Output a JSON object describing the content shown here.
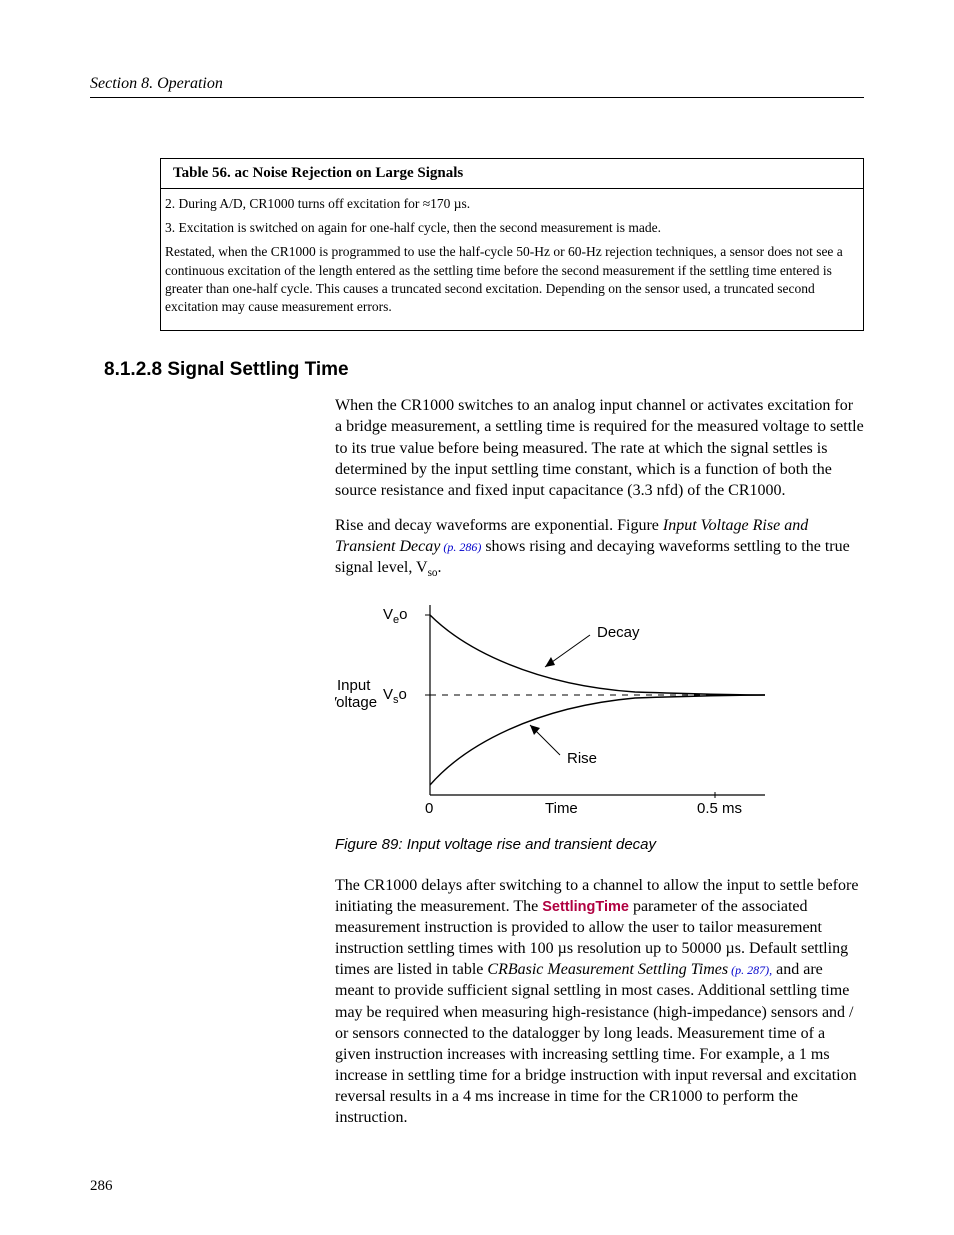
{
  "header": {
    "running": "Section 8.  Operation"
  },
  "table": {
    "title": "Table 56. ac Noise Rejection on Large Signals",
    "line2": "2. During A/D, CR1000 turns off excitation for ≈170 µs.",
    "line3": "3. Excitation is switched on again for one-half cycle, then the second measurement is made.",
    "para": "Restated, when the CR1000 is programmed to use the half-cycle 50-Hz or 60-Hz rejection techniques, a sensor does not see a continuous excitation of the length entered as the settling time before the second measurement if the settling time entered is greater than one-half cycle. This causes a truncated second excitation.  Depending on the sensor used, a truncated second excitation may cause measurement errors."
  },
  "section": {
    "heading": "8.1.2.8 Signal Settling Time",
    "p1": "When the CR1000 switches to an analog input channel or activates excitation for a bridge measurement, a settling time is required for the measured voltage to settle to its true value before being measured. The rate at which the signal settles is determined by the input settling time constant, which is a function of both the source resistance and fixed input capacitance (3.3 nfd) of the CR1000.",
    "p2a": "Rise and decay waveforms are exponential. Figure ",
    "p2b": "Input Voltage Rise and Transient Decay",
    "p2c": " (p. 286)",
    "p2d": " shows rising and decaying waveforms settling to the true signal level, V",
    "p2e": "so",
    "p2f": ".",
    "figcaption": "Figure 89: Input voltage rise and transient decay",
    "p3a": "The CR1000 delays after switching to a channel to allow the input to settle before initiating the measurement. The ",
    "p3b": "SettlingTime",
    "p3c": " parameter of the associated measurement instruction is provided to allow the user to tailor measurement instruction settling times with 100 µs resolution up to 50000 µs.  Default settling times are listed in table ",
    "p3d": "CRBasic Measurement Settling Times",
    "p3e": " (p. 287),",
    "p3f": " and are meant to provide sufficient signal settling in most cases. Additional settling time may be required when measuring high-resistance (high-impedance) sensors and / or sensors connected to the datalogger by long leads. Measurement time of a given instruction increases with increasing settling time. For example, a 1 ms increase in settling time for a bridge instruction with input reversal and excitation reversal results in a 4 ms increase in time for the CR1000 to perform the instruction."
  },
  "figure": {
    "ylabel1": "Input",
    "ylabel2": "Voltage",
    "ve": "V",
    "ve_sub": "e",
    "ve_o": "o",
    "vs": "V",
    "vs_sub": "s",
    "vs_o": "o",
    "decay": "Decay",
    "rise": "Rise",
    "x0": "0",
    "xlabel": "Time",
    "xend": "0.5 ms"
  },
  "chart_data": {
    "type": "line",
    "title": "Input voltage rise and transient decay",
    "xlabel": "Time",
    "ylabel": "Input Voltage",
    "x_range": [
      0,
      0.5
    ],
    "x_unit": "ms",
    "y_ticks": [
      "Vso",
      "Veo"
    ],
    "series": [
      {
        "name": "Decay",
        "description": "Exponential decay from Veo down to Vso",
        "x": [
          0,
          0.05,
          0.1,
          0.15,
          0.2,
          0.3,
          0.4,
          0.5
        ],
        "y_relative": [
          1.0,
          0.6,
          0.37,
          0.22,
          0.14,
          0.05,
          0.02,
          0.0
        ]
      },
      {
        "name": "Rise",
        "description": "Exponential rise from 0 up to Vso",
        "x": [
          0,
          0.05,
          0.1,
          0.15,
          0.2,
          0.3,
          0.4,
          0.5
        ],
        "y_relative": [
          0.0,
          0.4,
          0.63,
          0.78,
          0.86,
          0.95,
          0.98,
          1.0
        ]
      }
    ],
    "asymptote": "Vso"
  },
  "pagenum": "286"
}
